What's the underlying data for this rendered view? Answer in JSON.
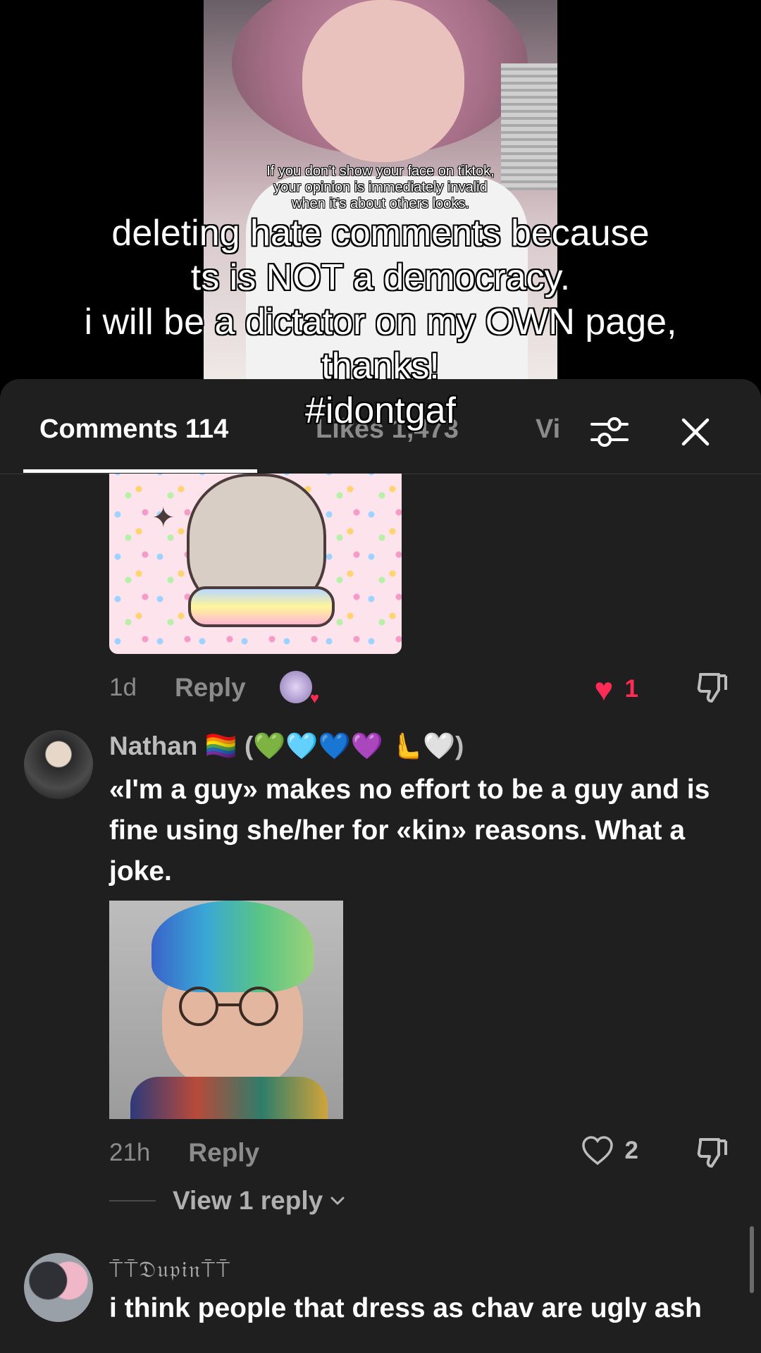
{
  "video": {
    "caption_lines": "If you don’t show your face on tiktok,\nyour opinion is immediately invalid\nwhen it’s about others looks."
  },
  "overlay": {
    "text": "deleting hate comments because\nts is NOT a democracy.\ni will be a dictator on my OWN page,\nthanks!\n#idontgaf"
  },
  "tabs": {
    "comments": "Comments 114",
    "likes": "Likes 1,473",
    "views_partial": "Vi"
  },
  "icons": {
    "filter": "sliders-icon",
    "close": "close-icon",
    "like_filled": "heart-filled-icon",
    "like_outline": "heart-outline-icon",
    "dislike": "thumbs-down-icon",
    "chevron": "chevron-down-icon"
  },
  "colors": {
    "sheet_bg": "#1f1f1f",
    "like_red": "#fe2c55",
    "muted": "#8b8b8b"
  },
  "comments": [
    {
      "time": "1d",
      "reply_label": "Reply",
      "likes": "1",
      "liked": true,
      "creator_liked": true
    },
    {
      "username": "Nathan 🏳️‍🌈 (💚🩵💙💜 🫷🤍)",
      "text": "«I'm a guy» makes no effort to be a guy and is fine using she/her for «kin» reasons. What a joke.",
      "time": "21h",
      "reply_label": "Reply",
      "likes": "2",
      "view_replies": "View 1 reply"
    },
    {
      "username": "⍑⍑𝔇𝔲𝔭𝔦𝔫⍑⍑",
      "text": "i think people that dress as chav are ugly ash"
    }
  ]
}
